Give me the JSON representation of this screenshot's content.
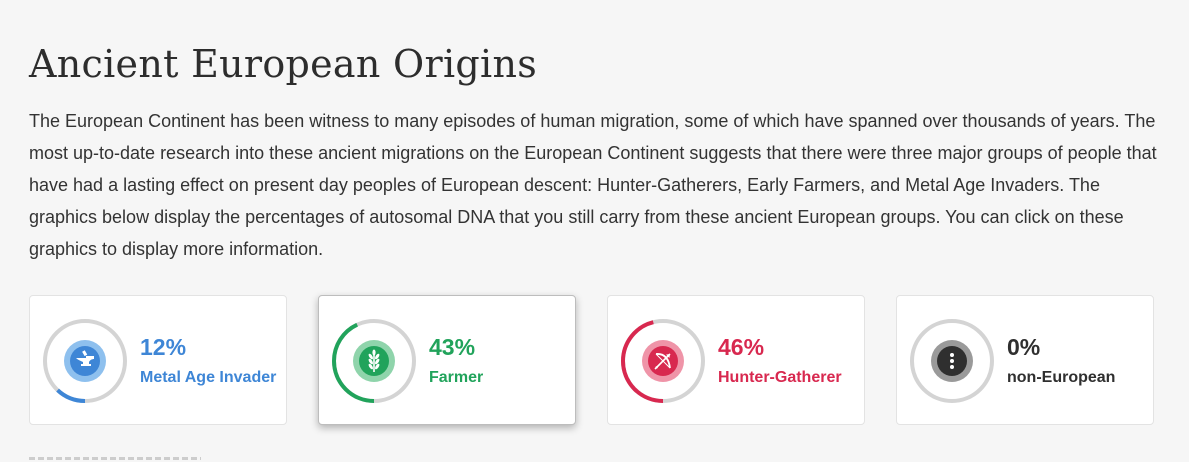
{
  "header": {
    "title": "Ancient European Origins"
  },
  "intro": {
    "text": "The European Continent has been witness to many episodes of human migration, some of which have spanned over thousands of years. The most up-to-date research into these ancient migrations on the European Continent suggests that there were three major groups of people that have had a lasting effect on present day peoples of European descent: Hunter-Gatherers, Early Farmers, and Metal Age Invaders. The graphics below display the percentages of autosomal DNA that you still carry from these ancient European groups. You can click on these graphics to display more information."
  },
  "cards": [
    {
      "id": "metal-age-invader",
      "percent_label": "12%",
      "value": 12,
      "label": "Metal Age Invader",
      "color": "#3e86d6",
      "icon": "anvil-icon",
      "selected": false
    },
    {
      "id": "farmer",
      "percent_label": "43%",
      "value": 43,
      "label": "Farmer",
      "color": "#21a35b",
      "icon": "wheat-icon",
      "selected": true
    },
    {
      "id": "hunter-gatherer",
      "percent_label": "46%",
      "value": 46,
      "label": "Hunter-Gatherer",
      "color": "#d8284f",
      "icon": "bow-arrow-icon",
      "selected": false
    },
    {
      "id": "non-european",
      "percent_label": "0%",
      "value": 0,
      "label": "non-European",
      "color": "#2f2f2f",
      "icon": "more-dots-icon",
      "selected": false
    }
  ],
  "track_color": "#d4d4d4"
}
